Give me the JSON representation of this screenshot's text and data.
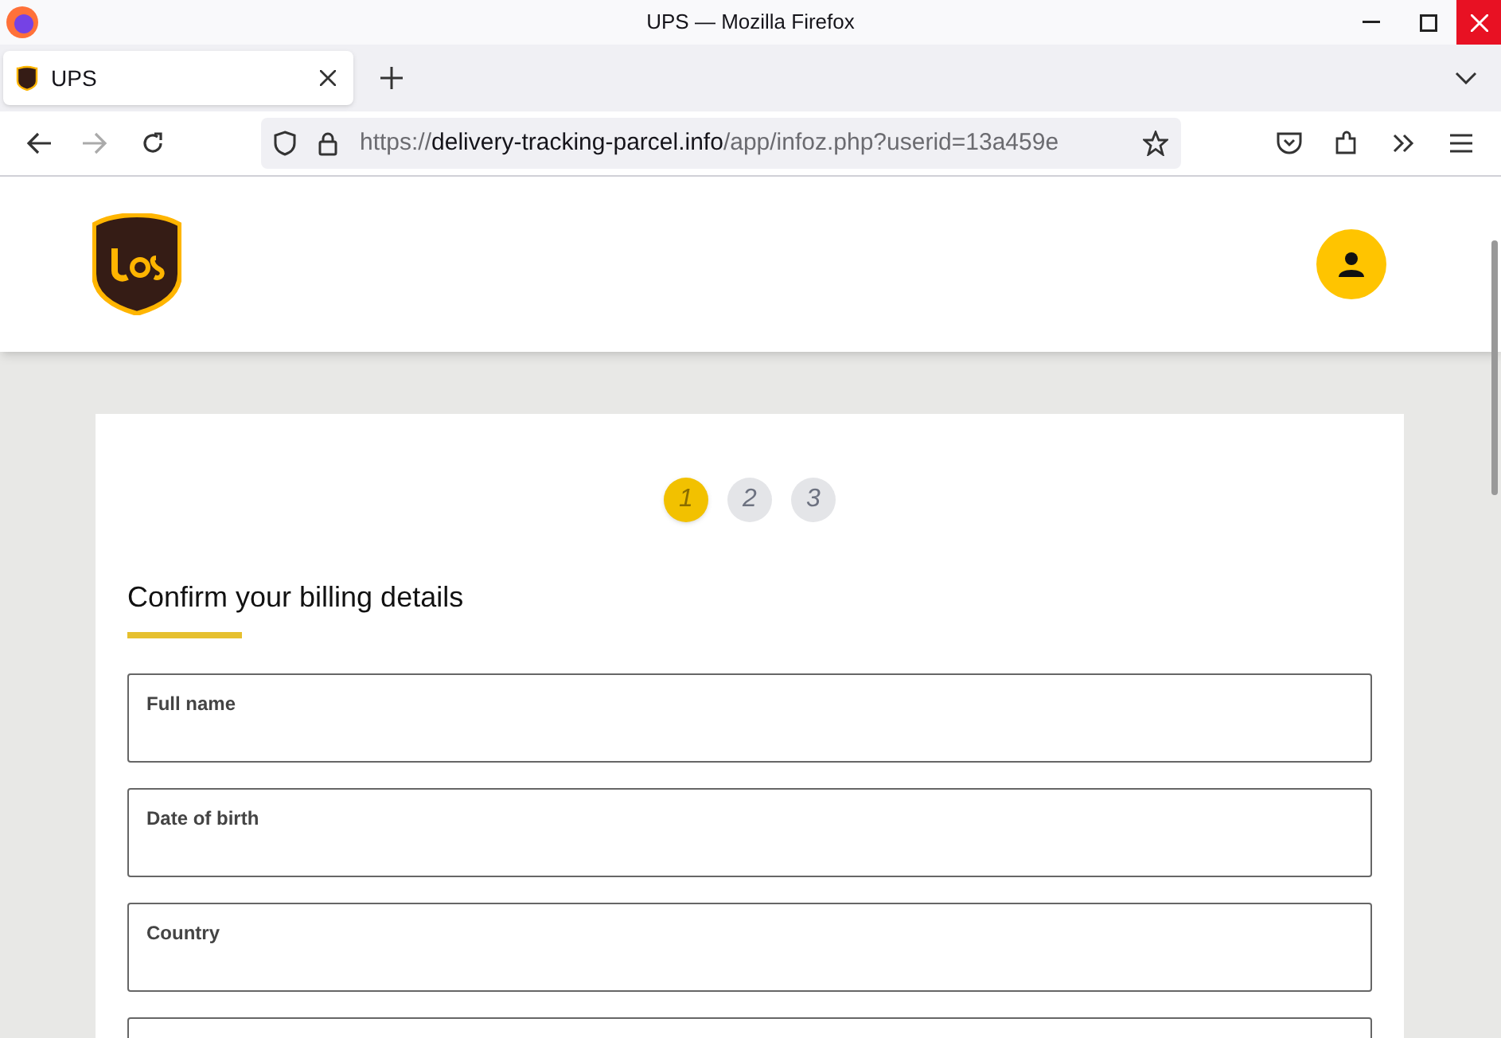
{
  "window": {
    "title": "UPS — Mozilla Firefox"
  },
  "tabs": [
    {
      "label": "UPS",
      "selected": true
    }
  ],
  "address_bar": {
    "scheme": "https://",
    "host": "delivery-tracking-parcel.info",
    "path": "/app/infoz.php?userid=13a459e"
  },
  "steps": [
    {
      "label": "1",
      "selected": true
    },
    {
      "label": "2",
      "selected": false
    },
    {
      "label": "3",
      "selected": false
    }
  ],
  "form": {
    "heading": "Confirm your billing details",
    "fields": [
      {
        "kind": "labeled",
        "label": "Full name"
      },
      {
        "kind": "labeled",
        "label": "Date of birth"
      },
      {
        "kind": "labeled",
        "label": "Country"
      },
      {
        "kind": "unlabeled"
      }
    ]
  }
}
